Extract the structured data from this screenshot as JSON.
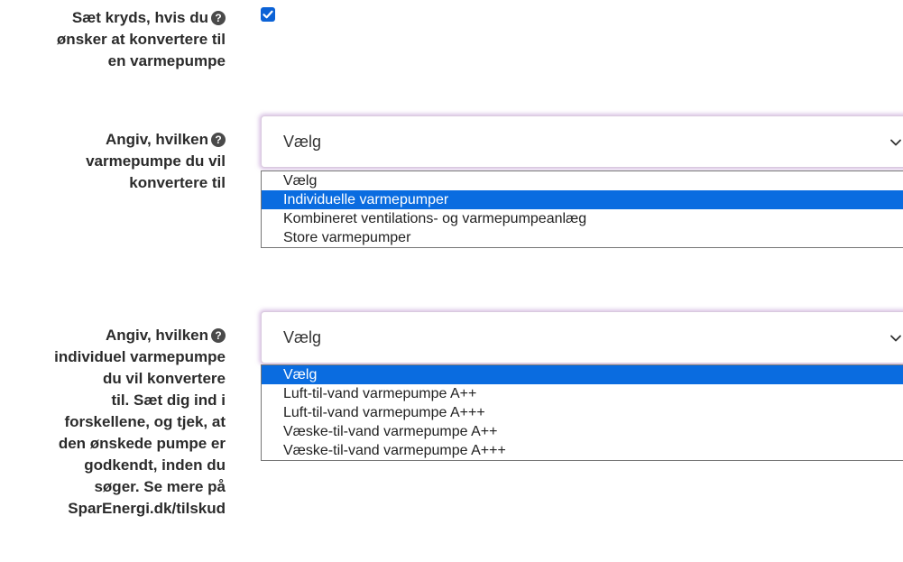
{
  "convert_question": {
    "label_lines": [
      "Sæt kryds, hvis du",
      "ønsker at konvertere til",
      "en varmepumpe"
    ],
    "checked": true
  },
  "heatpump_type": {
    "label_lines": [
      "Angiv, hvilken",
      "varmepumpe du vil",
      "konvertere til"
    ],
    "selected_value": "Vælg",
    "options": [
      {
        "label": "Vælg",
        "highlighted": false
      },
      {
        "label": "Individuelle varmepumper",
        "highlighted": true
      },
      {
        "label": "Kombineret ventilations- og varmepumpeanlæg",
        "highlighted": false
      },
      {
        "label": "Store varmepumper",
        "highlighted": false
      }
    ]
  },
  "individual_heatpump": {
    "label_lines": [
      "Angiv, hvilken",
      "individuel varmepumpe",
      "du vil konvertere",
      "til. Sæt dig ind i",
      "forskellene, og tjek, at",
      "den ønskede pumpe er",
      "godkendt, inden du",
      "søger. Se mere på",
      "SparEnergi.dk/tilskud"
    ],
    "selected_value": "Vælg",
    "options": [
      {
        "label": "Vælg",
        "highlighted": true
      },
      {
        "label": "Luft-til-vand varmepumpe A++",
        "highlighted": false
      },
      {
        "label": "Luft-til-vand varmepumpe A+++",
        "highlighted": false
      },
      {
        "label": "Væske-til-vand varmepumpe A++",
        "highlighted": false
      },
      {
        "label": "Væske-til-vand varmepumpe A+++",
        "highlighted": false
      }
    ]
  },
  "help_icon_glyph": "?",
  "colors": {
    "accent": "#0a6ce0",
    "checkbox": "#0b62d6",
    "focus_glow": "#be96d2"
  }
}
